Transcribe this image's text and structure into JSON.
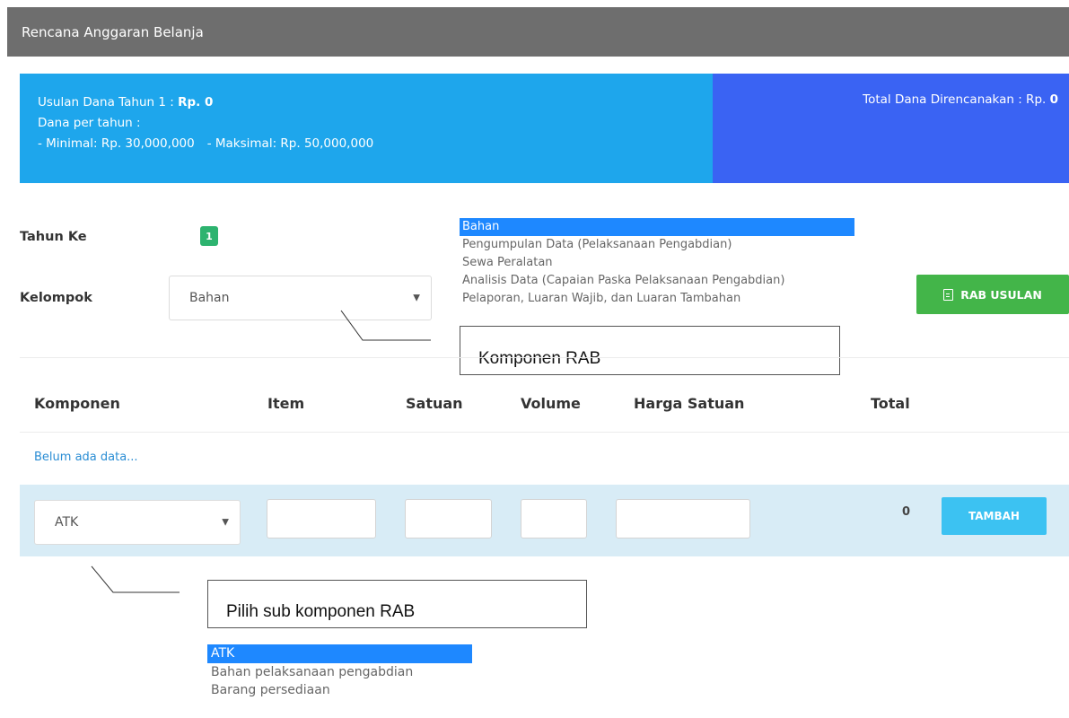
{
  "panel": {
    "title": "Rencana Anggaran Belanja"
  },
  "info": {
    "usulan_label": "Usulan Dana Tahun 1 : ",
    "usulan_value": "Rp. 0",
    "dana_per_tahun": "Dana per tahun :",
    "minimal": "- Minimal: Rp. 30,000,000",
    "maksimal": "- Maksimal: Rp. 50,000,000",
    "total_label": "Total Dana Direncanakan : Rp. ",
    "total_value": "0",
    "colors": {
      "left": "#1ea6ec",
      "right": "#3a63f3"
    }
  },
  "form": {
    "tahun_label": "Tahun Ke",
    "tahun_value": "1",
    "kelompok_label": "Kelompok",
    "kelompok_value": "Bahan"
  },
  "kelompok_options": [
    "Bahan",
    "Pengumpulan Data (Pelaksanaan Pengabdian)",
    "Sewa Peralatan",
    "Analisis Data (Capaian Paska Pelaksanaan Pengabdian)",
    "Pelaporan, Luaran Wajib, dan Luaran Tambahan"
  ],
  "callouts": {
    "komponen": "Komponen RAB",
    "sub_komponen": "Pilih sub komponen RAB"
  },
  "buttons": {
    "rab_usulan": "RAB USULAN",
    "tambah": "TAMBAH"
  },
  "table": {
    "headers": [
      "Komponen",
      "Item",
      "Satuan",
      "Volume",
      "Harga Satuan",
      "Total"
    ],
    "empty": "Belum ada data...",
    "row_select_value": "ATK",
    "row_total": "0"
  },
  "sub_options": [
    "ATK",
    "Bahan pelaksanaan pengabdian",
    "Barang persediaan"
  ],
  "icons": {
    "rab_button": "document-icon",
    "select": "caret-down-icon"
  }
}
